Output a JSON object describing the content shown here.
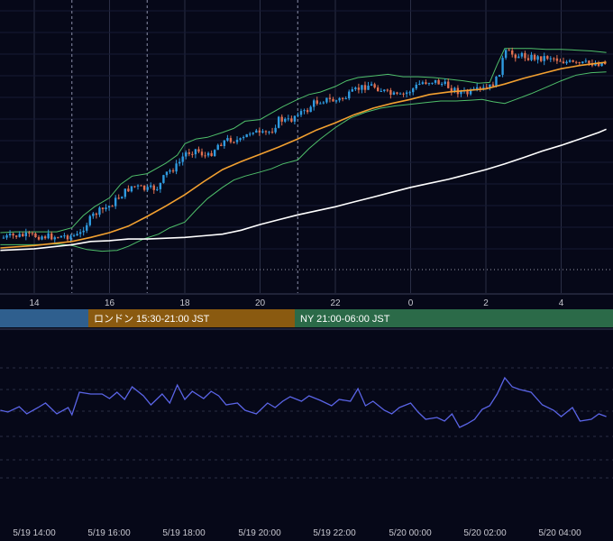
{
  "chart_data": [
    {
      "type": "candlestick",
      "x_unit": "hour of day (JST)",
      "xlim": [
        13.1,
        29.2
      ],
      "ylim": [
        -10,
        325
      ],
      "grid": true,
      "x_ticks": [
        {
          "x": 14,
          "label": "14"
        },
        {
          "x": 16,
          "label": "16"
        },
        {
          "x": 18,
          "label": "18"
        },
        {
          "x": 20,
          "label": "20"
        },
        {
          "x": 22,
          "label": "22"
        },
        {
          "x": 24,
          "label": "0"
        },
        {
          "x": 26,
          "label": "2"
        },
        {
          "x": 28,
          "label": "4"
        }
      ],
      "session_marker_hours": [
        15,
        17,
        21
      ],
      "close_path": [
        [
          13.1,
          275
        ],
        [
          13.5,
          272
        ],
        [
          14.0,
          272
        ],
        [
          14.5,
          273
        ],
        [
          15.0,
          272
        ],
        [
          15.2,
          272
        ],
        [
          15.3,
          262
        ],
        [
          15.6,
          245
        ],
        [
          16.0,
          235
        ],
        [
          16.3,
          222
        ],
        [
          16.6,
          210
        ],
        [
          17.0,
          215
        ],
        [
          17.3,
          212
        ],
        [
          17.5,
          195
        ],
        [
          17.8,
          185
        ],
        [
          18.0,
          170
        ],
        [
          18.3,
          165
        ],
        [
          18.6,
          175
        ],
        [
          18.9,
          158
        ],
        [
          19.2,
          152
        ],
        [
          19.5,
          155
        ],
        [
          19.8,
          140
        ],
        [
          20.0,
          148
        ],
        [
          20.3,
          142
        ],
        [
          20.5,
          128
        ],
        [
          20.8,
          130
        ],
        [
          21.0,
          118
        ],
        [
          21.2,
          120
        ],
        [
          21.4,
          108
        ],
        [
          21.7,
          103
        ],
        [
          22.0,
          105
        ],
        [
          22.3,
          100
        ],
        [
          22.6,
          90
        ],
        [
          22.9,
          85
        ],
        [
          23.1,
          88
        ],
        [
          23.4,
          96
        ],
        [
          23.7,
          100
        ],
        [
          24.0,
          92
        ],
        [
          24.3,
          82
        ],
        [
          24.6,
          80
        ],
        [
          24.9,
          85
        ],
        [
          25.2,
          92
        ],
        [
          25.5,
          96
        ],
        [
          25.8,
          92
        ],
        [
          26.1,
          88
        ],
        [
          26.3,
          78
        ],
        [
          26.5,
          45
        ],
        [
          26.8,
          48
        ],
        [
          27.1,
          50
        ],
        [
          27.4,
          52
        ],
        [
          27.7,
          50
        ],
        [
          28.0,
          55
        ],
        [
          28.4,
          60
        ],
        [
          28.8,
          58
        ],
        [
          29.2,
          58
        ]
      ],
      "ma_short_path": [
        [
          13.1,
          287
        ],
        [
          14.0,
          284
        ],
        [
          15.0,
          279
        ],
        [
          15.5,
          274
        ],
        [
          16.0,
          268
        ],
        [
          16.5,
          260
        ],
        [
          17.0,
          248
        ],
        [
          17.5,
          235
        ],
        [
          18.0,
          221
        ],
        [
          18.5,
          205
        ],
        [
          19.0,
          190
        ],
        [
          19.5,
          180
        ],
        [
          20.0,
          171
        ],
        [
          20.5,
          162
        ],
        [
          21.0,
          152
        ],
        [
          21.5,
          141
        ],
        [
          22.0,
          132
        ],
        [
          22.5,
          122
        ],
        [
          23.0,
          114
        ],
        [
          23.5,
          108
        ],
        [
          24.0,
          103
        ],
        [
          24.5,
          97
        ],
        [
          25.0,
          94
        ],
        [
          25.5,
          92
        ],
        [
          26.0,
          90
        ],
        [
          26.5,
          84
        ],
        [
          27.0,
          77
        ],
        [
          27.5,
          71
        ],
        [
          28.0,
          65
        ],
        [
          28.5,
          61
        ],
        [
          29.0,
          58
        ],
        [
          29.2,
          57
        ]
      ],
      "ma_long_path": [
        [
          13.1,
          290
        ],
        [
          14.0,
          288
        ],
        [
          15.0,
          283
        ],
        [
          15.5,
          279
        ],
        [
          16.0,
          278
        ],
        [
          16.5,
          276
        ],
        [
          17.0,
          276
        ],
        [
          18.0,
          274
        ],
        [
          18.5,
          272
        ],
        [
          19.0,
          270
        ],
        [
          19.5,
          265
        ],
        [
          20.0,
          258
        ],
        [
          20.5,
          252
        ],
        [
          21.0,
          246
        ],
        [
          21.5,
          241
        ],
        [
          22.0,
          236
        ],
        [
          22.5,
          230
        ],
        [
          23.0,
          224
        ],
        [
          23.5,
          218
        ],
        [
          24.0,
          212
        ],
        [
          24.5,
          207
        ],
        [
          25.0,
          202
        ],
        [
          25.5,
          196
        ],
        [
          26.0,
          190
        ],
        [
          26.5,
          183
        ],
        [
          27.0,
          175
        ],
        [
          27.5,
          167
        ],
        [
          28.0,
          160
        ],
        [
          28.5,
          152
        ],
        [
          29.0,
          144
        ],
        [
          29.2,
          140
        ]
      ],
      "band_upper_path": [
        [
          13.1,
          268
        ],
        [
          13.5,
          267
        ],
        [
          14.0,
          267
        ],
        [
          14.6,
          267
        ],
        [
          15.0,
          262
        ],
        [
          15.3,
          247
        ],
        [
          15.6,
          236
        ],
        [
          16.0,
          225
        ],
        [
          16.3,
          208
        ],
        [
          16.6,
          198
        ],
        [
          17.0,
          195
        ],
        [
          17.5,
          182
        ],
        [
          17.8,
          172
        ],
        [
          18.0,
          158
        ],
        [
          18.3,
          152
        ],
        [
          18.6,
          150
        ],
        [
          19.0,
          144
        ],
        [
          19.3,
          139
        ],
        [
          19.6,
          130
        ],
        [
          20.0,
          128
        ],
        [
          20.3,
          120
        ],
        [
          20.6,
          112
        ],
        [
          21.0,
          103
        ],
        [
          21.3,
          97
        ],
        [
          21.6,
          94
        ],
        [
          22.0,
          87
        ],
        [
          22.3,
          80
        ],
        [
          22.6,
          76
        ],
        [
          23.0,
          74
        ],
        [
          23.4,
          72
        ],
        [
          23.8,
          75
        ],
        [
          24.2,
          75
        ],
        [
          24.6,
          76
        ],
        [
          25.0,
          78
        ],
        [
          25.4,
          80
        ],
        [
          25.8,
          83
        ],
        [
          26.1,
          82
        ],
        [
          26.3,
          60
        ],
        [
          26.5,
          40
        ],
        [
          26.8,
          40
        ],
        [
          27.2,
          40
        ],
        [
          27.6,
          41
        ],
        [
          28.0,
          41
        ],
        [
          28.4,
          42
        ],
        [
          28.8,
          43
        ],
        [
          29.2,
          45
        ]
      ],
      "band_lower_path": [
        [
          13.1,
          283
        ],
        [
          13.5,
          283
        ],
        [
          14.0,
          283
        ],
        [
          14.6,
          282
        ],
        [
          15.0,
          284
        ],
        [
          15.4,
          289
        ],
        [
          15.8,
          291
        ],
        [
          16.2,
          290
        ],
        [
          16.5,
          285
        ],
        [
          16.9,
          276
        ],
        [
          17.3,
          270
        ],
        [
          17.6,
          262
        ],
        [
          18.0,
          255
        ],
        [
          18.3,
          240
        ],
        [
          18.6,
          226
        ],
        [
          19.0,
          212
        ],
        [
          19.3,
          203
        ],
        [
          19.6,
          198
        ],
        [
          20.0,
          193
        ],
        [
          20.3,
          189
        ],
        [
          20.6,
          183
        ],
        [
          21.0,
          178
        ],
        [
          21.3,
          164
        ],
        [
          21.6,
          152
        ],
        [
          22.0,
          138
        ],
        [
          22.4,
          126
        ],
        [
          22.8,
          119
        ],
        [
          23.2,
          114
        ],
        [
          23.6,
          111
        ],
        [
          24.0,
          109
        ],
        [
          24.4,
          107
        ],
        [
          24.8,
          105
        ],
        [
          25.2,
          105
        ],
        [
          25.6,
          104
        ],
        [
          25.9,
          103
        ],
        [
          26.2,
          106
        ],
        [
          26.5,
          108
        ],
        [
          26.8,
          103
        ],
        [
          27.2,
          96
        ],
        [
          27.6,
          88
        ],
        [
          28.0,
          80
        ],
        [
          28.4,
          73
        ],
        [
          28.8,
          70
        ],
        [
          29.2,
          69
        ]
      ],
      "oscillator_path": [
        [
          13.1,
          48
        ],
        [
          13.3,
          50
        ],
        [
          13.6,
          44
        ],
        [
          13.8,
          52
        ],
        [
          14.1,
          45
        ],
        [
          14.3,
          40
        ],
        [
          14.6,
          52
        ],
        [
          14.9,
          45
        ],
        [
          15.0,
          53
        ],
        [
          15.2,
          28
        ],
        [
          15.5,
          30
        ],
        [
          15.8,
          30
        ],
        [
          16.0,
          35
        ],
        [
          16.2,
          28
        ],
        [
          16.4,
          36
        ],
        [
          16.6,
          22
        ],
        [
          16.9,
          32
        ],
        [
          17.1,
          42
        ],
        [
          17.4,
          30
        ],
        [
          17.6,
          40
        ],
        [
          17.8,
          20
        ],
        [
          18.0,
          36
        ],
        [
          18.2,
          27
        ],
        [
          18.5,
          35
        ],
        [
          18.7,
          27
        ],
        [
          18.9,
          32
        ],
        [
          19.1,
          42
        ],
        [
          19.4,
          40
        ],
        [
          19.6,
          48
        ],
        [
          19.9,
          52
        ],
        [
          20.2,
          40
        ],
        [
          20.4,
          45
        ],
        [
          20.6,
          38
        ],
        [
          20.8,
          33
        ],
        [
          21.1,
          38
        ],
        [
          21.3,
          32
        ],
        [
          21.6,
          37
        ],
        [
          21.9,
          43
        ],
        [
          22.1,
          36
        ],
        [
          22.4,
          38
        ],
        [
          22.6,
          24
        ],
        [
          22.8,
          43
        ],
        [
          23.0,
          38
        ],
        [
          23.3,
          48
        ],
        [
          23.5,
          52
        ],
        [
          23.7,
          45
        ],
        [
          24.0,
          40
        ],
        [
          24.2,
          50
        ],
        [
          24.4,
          58
        ],
        [
          24.7,
          56
        ],
        [
          24.9,
          60
        ],
        [
          25.1,
          52
        ],
        [
          25.3,
          67
        ],
        [
          25.5,
          63
        ],
        [
          25.7,
          58
        ],
        [
          25.9,
          47
        ],
        [
          26.1,
          43
        ],
        [
          26.3,
          30
        ],
        [
          26.5,
          12
        ],
        [
          26.7,
          22
        ],
        [
          26.9,
          25
        ],
        [
          27.2,
          28
        ],
        [
          27.5,
          42
        ],
        [
          27.8,
          48
        ],
        [
          28.0,
          55
        ],
        [
          28.3,
          45
        ],
        [
          28.5,
          60
        ],
        [
          28.8,
          58
        ],
        [
          29.0,
          52
        ],
        [
          29.2,
          55
        ]
      ]
    }
  ],
  "sessions": [
    {
      "label": "",
      "color": "#2f5f8e"
    },
    {
      "label": "ロンドン 15:30-21:00 JST",
      "color": "#8a5a10"
    },
    {
      "label": "NY 21:00-06:00 JST",
      "color": "#2b6a48"
    }
  ],
  "bottom_axis": {
    "labels": [
      "5/19 14:00",
      "5/19 16:00",
      "5/19 18:00",
      "5/19 20:00",
      "5/19 22:00",
      "5/20 00:00",
      "5/20 02:00",
      "5/20 04:00"
    ]
  },
  "colors": {
    "background": "#060818",
    "grid": "#2a2e45",
    "candle_up": "#2f9be0",
    "candle_down": "#e07050",
    "ma_short": "#f2a030",
    "ma_long": "#ffffff",
    "band": "#4fbf6a",
    "oscillator": "#5a64e6"
  }
}
